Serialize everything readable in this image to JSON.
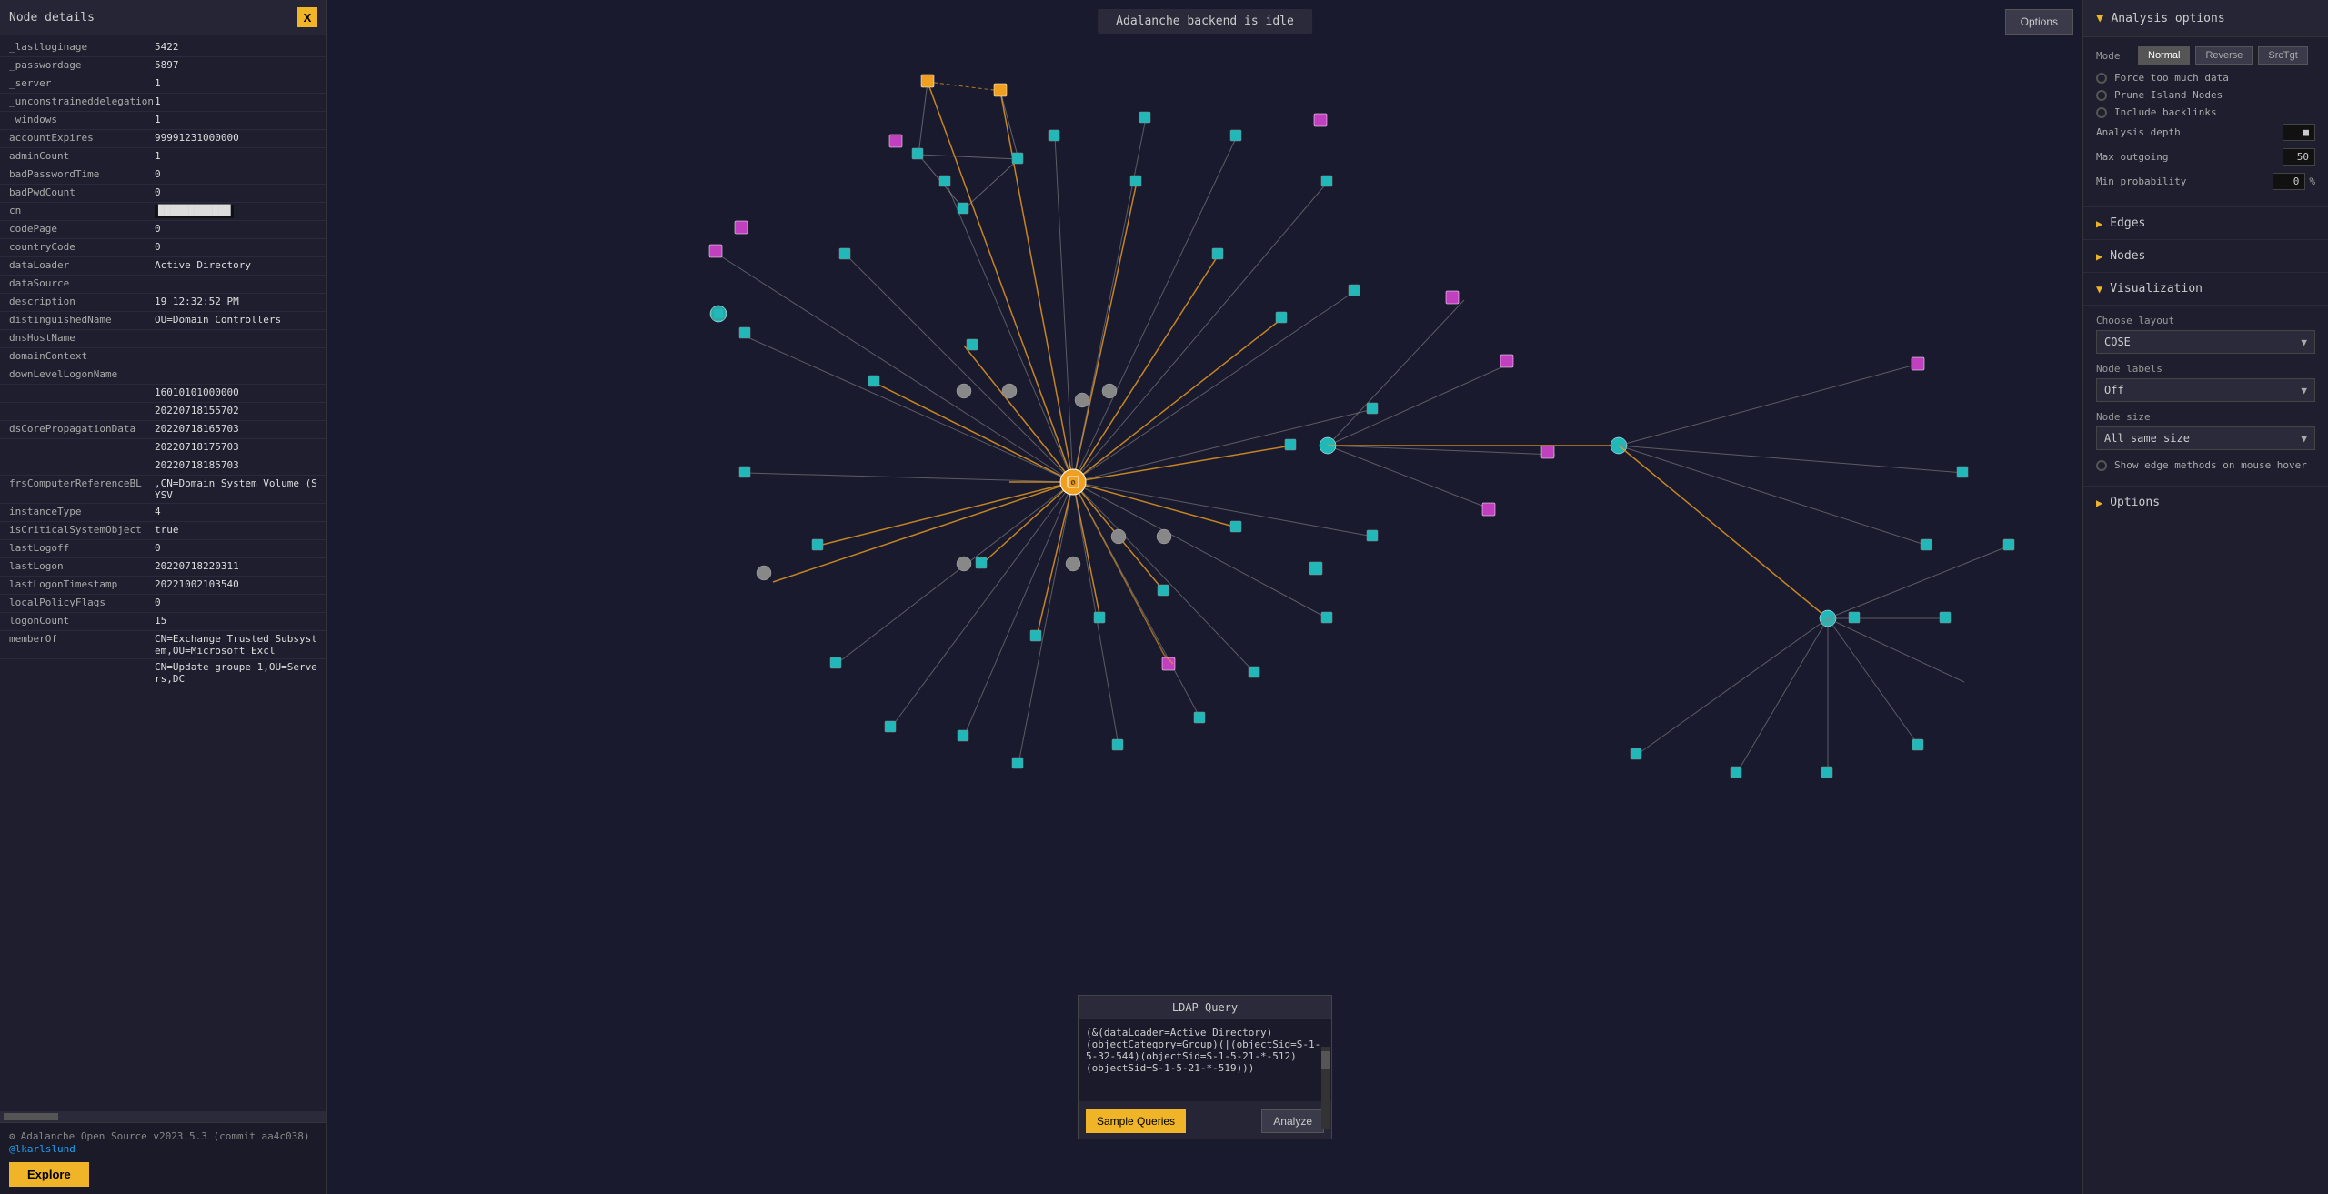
{
  "leftPanel": {
    "title": "Node details",
    "closeBtn": "X",
    "properties": [
      {
        "key": "_lastloginage",
        "value": "5422"
      },
      {
        "key": "_passwordage",
        "value": "5897"
      },
      {
        "key": "_server",
        "value": "1"
      },
      {
        "key": "_unconstraineddelegation",
        "value": "1"
      },
      {
        "key": "_windows",
        "value": "1"
      },
      {
        "key": "accountExpires",
        "value": "99991231000000"
      },
      {
        "key": "adminCount",
        "value": "1"
      },
      {
        "key": "badPasswordTime",
        "value": "0"
      },
      {
        "key": "badPwdCount",
        "value": "0"
      },
      {
        "key": "cn",
        "value": "████████████"
      },
      {
        "key": "codePage",
        "value": "0"
      },
      {
        "key": "countryCode",
        "value": "0"
      },
      {
        "key": "dataLoader",
        "value": "Active Directory"
      },
      {
        "key": "dataSource",
        "value": ""
      },
      {
        "key": "description",
        "value": "19 12:32:52 PM"
      },
      {
        "key": "distinguishedName",
        "value": "OU=Domain Controllers"
      },
      {
        "key": "dnsHostName",
        "value": ""
      },
      {
        "key": "domainContext",
        "value": ""
      },
      {
        "key": "downLevelLogonName",
        "value": ""
      },
      {
        "key": "",
        "value": "16010101000000"
      },
      {
        "key": "",
        "value": "20220718155702"
      },
      {
        "key": "dsCorePropagationData",
        "value": "20220718165703"
      },
      {
        "key": "",
        "value": "20220718175703"
      },
      {
        "key": "",
        "value": "20220718185703"
      },
      {
        "key": "frsComputerReferenceBL",
        "value": ",CN=Domain System Volume (SYSV"
      },
      {
        "key": "instanceType",
        "value": "4"
      },
      {
        "key": "isCriticalSystemObject",
        "value": "true"
      },
      {
        "key": "lastLogoff",
        "value": "0"
      },
      {
        "key": "lastLogon",
        "value": "20220718220311"
      },
      {
        "key": "lastLogonTimestamp",
        "value": "20221002103540"
      },
      {
        "key": "localPolicyFlags",
        "value": "0"
      },
      {
        "key": "logonCount",
        "value": "15"
      },
      {
        "key": "memberOf",
        "value": "CN=Exchange Trusted Subsystem,OU=Microsoft Excl"
      },
      {
        "key": "",
        "value": "CN=Update groupe 1,OU=Servers,DC"
      }
    ],
    "footer": {
      "version": "Adalanche Open Source v2023.5.3 (commit aa4c038)",
      "twitterHandle": "@lkarlslund",
      "exploreBtn": "Explore"
    }
  },
  "statusBar": {
    "text": "Adalanche backend is idle"
  },
  "optionsBtn": "Options",
  "ldapQuery": {
    "title": "LDAP Query",
    "value": "(&(dataLoader=Active Directory)(objectCategory=Group)(|(objectSid=S-1-5-32-544)(objectSid=S-1-5-21-*-512)(objectSid=S-1-5-21-*-519)))",
    "sampleQueriesBtn": "Sample Queries",
    "analyzeBtn": "Analyze"
  },
  "rightPanel": {
    "title": "Analysis options",
    "collapseIcon": "▼",
    "mode": {
      "label": "Mode",
      "buttons": [
        "Normal",
        "Reverse",
        "SrcTgt"
      ],
      "active": "Normal"
    },
    "checkboxes": [
      {
        "label": "Force too much data",
        "checked": false
      },
      {
        "label": "Prune Island Nodes",
        "checked": false
      },
      {
        "label": "Include backlinks",
        "checked": false
      }
    ],
    "analysisDepth": {
      "label": "Analysis depth",
      "value": ""
    },
    "maxOutgoing": {
      "label": "Max outgoing",
      "value": "50"
    },
    "minProbability": {
      "label": "Min probability",
      "value": "0",
      "unit": "%"
    },
    "sections": [
      {
        "label": "Edges",
        "expanded": false,
        "chevron": "▶"
      },
      {
        "label": "Nodes",
        "expanded": false,
        "chevron": "▶"
      },
      {
        "label": "Visualization",
        "expanded": true,
        "chevron": "▼"
      }
    ],
    "visualization": {
      "chooseLayout": {
        "label": "Choose layout",
        "value": "COSE"
      },
      "nodeLabels": {
        "label": "Node labels",
        "value": "Off"
      },
      "nodeSize": {
        "label": "Node size",
        "value": "All same size"
      },
      "showEdgeMethods": {
        "label": "Show edge methods on mouse hover",
        "checked": false
      }
    },
    "optionsSection": {
      "label": "Options",
      "chevron": "▶"
    }
  }
}
